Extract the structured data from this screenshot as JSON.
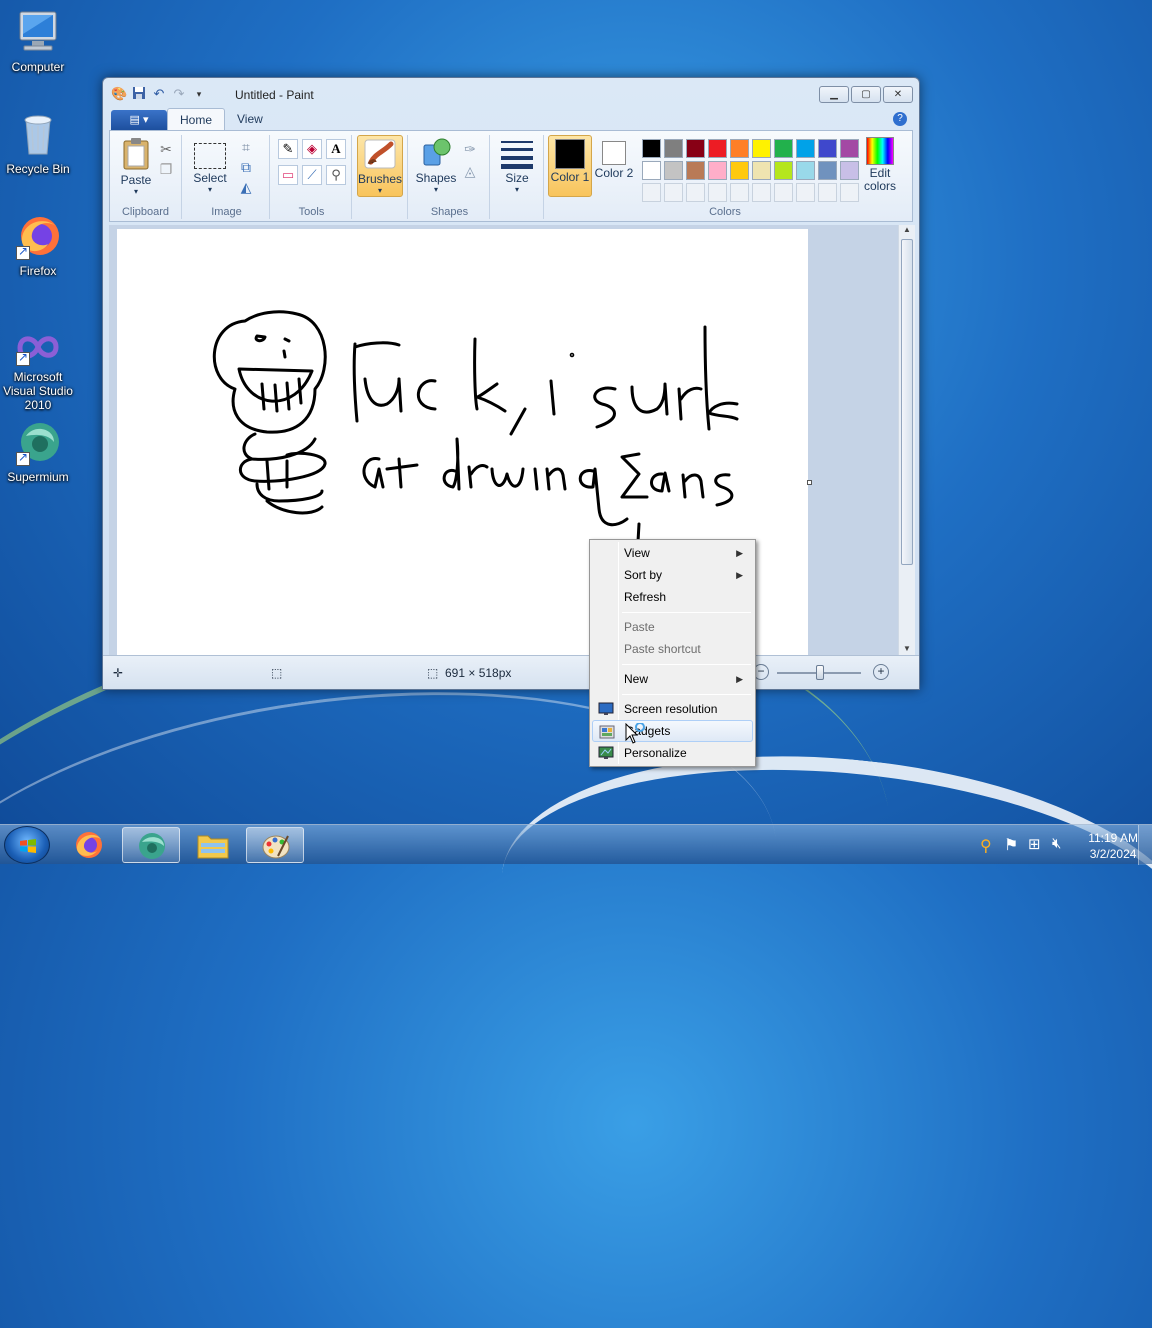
{
  "desktop": {
    "icons": [
      {
        "label": "Computer"
      },
      {
        "label": "Recycle Bin"
      },
      {
        "label": "Firefox"
      },
      {
        "label": "Microsoft Visual Studio 2010"
      },
      {
        "label": "Supermium"
      }
    ]
  },
  "paint": {
    "title": "Untitled - Paint",
    "tabs": [
      "Home",
      "View"
    ],
    "groups": {
      "clipboard": "Clipboard",
      "image": "Image",
      "tools": "Tools",
      "shapes": "Shapes",
      "colors": "Colors"
    },
    "buttons": {
      "paste": "Paste",
      "select": "Select",
      "brushes": "Brushes",
      "shapes": "Shapes",
      "size": "Size",
      "color1": "Color 1",
      "color2": "Color 2",
      "edit_colors": "Edit colors"
    },
    "palette_row1": [
      "#000000",
      "#7f7f7f",
      "#880015",
      "#ed1c24",
      "#ff7f27",
      "#fff200",
      "#22b14c",
      "#00a2e8",
      "#3f48cc",
      "#a349a4"
    ],
    "palette_row2": [
      "#ffffff",
      "#c3c3c3",
      "#b97a57",
      "#ffaec9",
      "#ffc90e",
      "#efe4b0",
      "#b5e61d",
      "#99d9ea",
      "#7092be",
      "#c8bfe7"
    ],
    "status": {
      "canvas_size": "691 × 518px"
    }
  },
  "context_menu": {
    "items": [
      {
        "label": "View"
      },
      {
        "label": "Sort by"
      },
      {
        "label": "Refresh"
      },
      {
        "label": "Paste"
      },
      {
        "label": "Paste shortcut"
      },
      {
        "label": "New"
      },
      {
        "label": "Screen resolution"
      },
      {
        "label": "Gadgets"
      },
      {
        "label": "Personalize"
      }
    ]
  },
  "taskbar": {
    "time": "11:19 AM",
    "date": "3/2/2024"
  }
}
